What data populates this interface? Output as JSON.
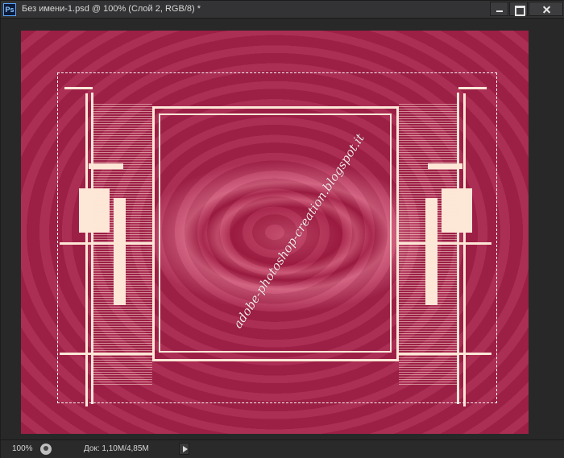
{
  "app": {
    "icon_label": "Ps",
    "title": "Без имени-1.psd @ 100% (Слой 2, RGB/8) *"
  },
  "window_controls": {
    "minimize_icon": "minimize-icon",
    "restore_icon": "restore-icon",
    "close_icon": "close-icon"
  },
  "canvas": {
    "watermark": "adobe-photoshop-creation.blogspot.it",
    "colors": {
      "background": "#a51d44",
      "frame": "#fde7d7",
      "selection": "#f3f3f3"
    }
  },
  "status": {
    "zoom": "100%",
    "doc_info": "Док: 1,10M/4,85M",
    "arrow_icon": "play-arrow-icon"
  }
}
